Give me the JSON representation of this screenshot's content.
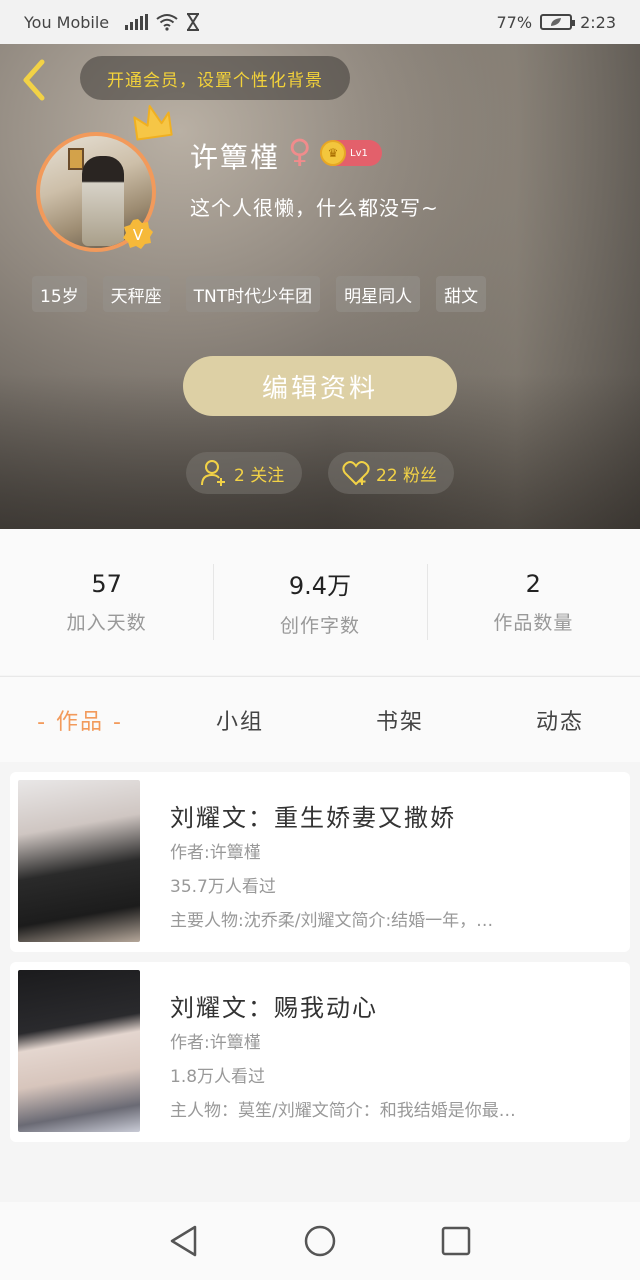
{
  "status_bar": {
    "carrier": "You Mobile",
    "battery": "77",
    "time": "2:23"
  },
  "header": {
    "vip_banner": "开通会员，设置个性化背景",
    "username": "许簟槿",
    "gender_symbol": "♀",
    "level": "Lv1",
    "bio": "这个人很懒，什么都没写~",
    "tags": [
      "15岁",
      "天秤座",
      "TNT时代少年团",
      "明星同人",
      "甜文"
    ],
    "edit_button": "编辑资料",
    "follow_label": "2 关注",
    "fans_label": "22 粉丝"
  },
  "stats": [
    {
      "value": "57",
      "label": "加入天数"
    },
    {
      "value": "9.4万",
      "label": "创作字数"
    },
    {
      "value": "2",
      "label": "作品数量"
    }
  ],
  "tabs": [
    {
      "label": "- 作品 -",
      "active": true
    },
    {
      "label": "小组",
      "active": false
    },
    {
      "label": "书架",
      "active": false
    },
    {
      "label": "动态",
      "active": false
    }
  ],
  "works": [
    {
      "title": "刘耀文：重生娇妻又撒娇",
      "author": "作者:许簟槿",
      "views": "35.7万人看过",
      "desc": "主要人物:沈乔柔/刘耀文简介:结婚一年，…"
    },
    {
      "title": "刘耀文：赐我动心",
      "author": "作者:许簟槿",
      "views": "1.8万人看过",
      "desc": "主人物：莫笙/刘耀文简介：和我结婚是你最…"
    }
  ],
  "colors": {
    "accent": "#f29a5b",
    "gold": "#f2d246",
    "edit_button": "#ddd0a5"
  },
  "icons": [
    "back-arrow-icon",
    "crown-icon",
    "v-badge-icon",
    "add-user-icon",
    "heart-icon",
    "nav-back-icon",
    "nav-home-icon",
    "nav-recent-icon"
  ]
}
